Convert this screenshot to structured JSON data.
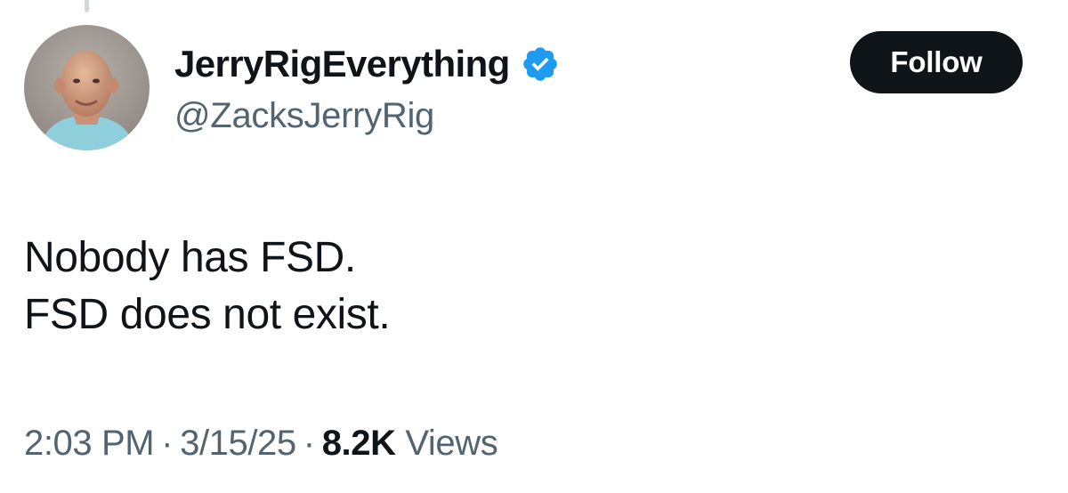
{
  "tweet": {
    "author": {
      "display_name": "JerryRigEverything",
      "handle": "@ZacksJerryRig",
      "verified": true,
      "verified_color": "#1d9bf0",
      "avatar": "profile-photo"
    },
    "follow_label": "Follow",
    "text_lines": [
      "Nobody has FSD.",
      "FSD does not exist."
    ],
    "time": "2:03 PM",
    "separator": "·",
    "date": "3/15/25",
    "views_count": "8.2K",
    "views_label": "Views"
  },
  "colors": {
    "text_primary": "#0f1419",
    "text_secondary": "#536471",
    "button_bg": "#0f1419",
    "button_text": "#ffffff"
  }
}
